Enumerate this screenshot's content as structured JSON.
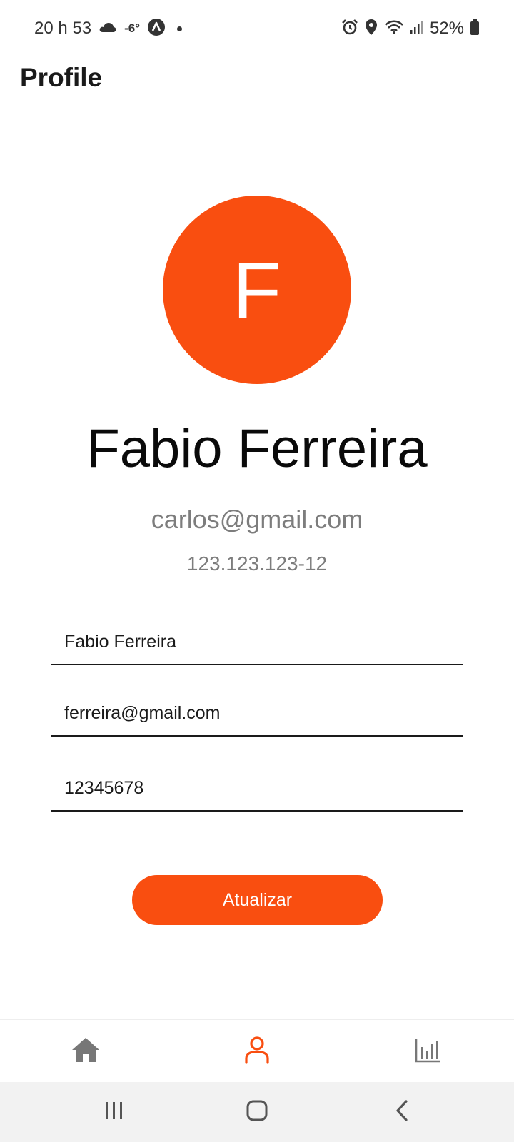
{
  "status_bar": {
    "time": "20 h 53",
    "temperature": "-6°",
    "battery": "52%",
    "left_icons": [
      "cloud-icon",
      "navigation-app-icon",
      "notification-dot-icon"
    ],
    "right_icons": [
      "alarm-icon",
      "location-icon",
      "wifi-icon",
      "signal-icon",
      "battery-icon"
    ]
  },
  "header": {
    "title": "Profile"
  },
  "profile": {
    "avatar_initial": "F",
    "name": "Fabio Ferreira",
    "email": "carlos@gmail.com",
    "document": "123.123.123-12"
  },
  "form": {
    "name_value": "Fabio Ferreira",
    "email_value": "ferreira@gmail.com",
    "password_value": "12345678",
    "submit_label": "Atualizar"
  },
  "bottom_nav": {
    "items": [
      {
        "icon": "home-icon",
        "active": false
      },
      {
        "icon": "user-icon",
        "active": true
      },
      {
        "icon": "bar-chart-icon",
        "active": false
      }
    ]
  },
  "system_nav": {
    "items": [
      "recent-apps-icon",
      "home-circle-icon",
      "back-icon"
    ]
  },
  "colors": {
    "accent": "#f94e10",
    "inactive_icon": "#777777",
    "text_primary": "#0a0a0a",
    "text_secondary": "#7d7d7d"
  }
}
